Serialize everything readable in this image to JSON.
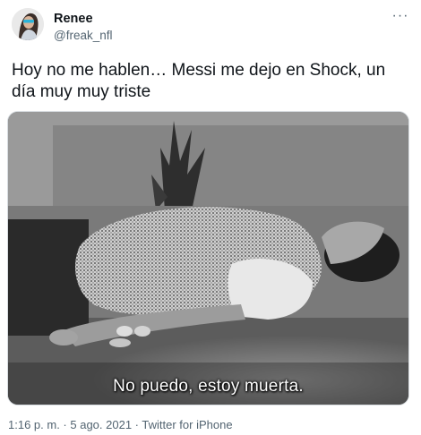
{
  "author": {
    "display_name": "Renee",
    "handle": "@freak_nfl"
  },
  "more_button": "···",
  "tweet_text": "Hoy no me hablen… Messi me dejo en Shock, un día muy muy triste",
  "media": {
    "subtitle": "No puedo, estoy muerta."
  },
  "meta": {
    "time": "1:16 p. m.",
    "separator1": " · ",
    "date": "5 ago. 2021",
    "separator2": " · ",
    "source": "Twitter for iPhone"
  },
  "colors": {
    "text_primary": "#0f1419",
    "text_secondary": "#536471"
  }
}
